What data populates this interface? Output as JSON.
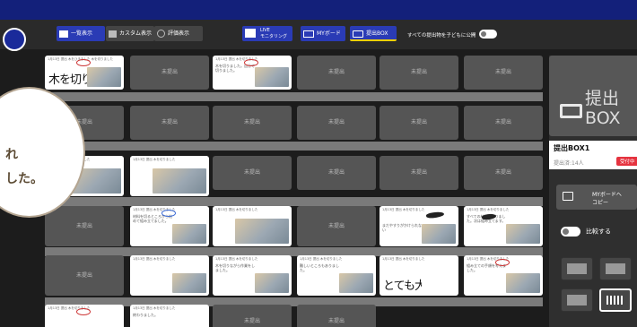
{
  "toolbar": {
    "list_view": "一覧表示",
    "custom_view": "カスタム表示",
    "eval_view": "評価表示",
    "live_top": "LIVE",
    "live_bottom": "モニタリング",
    "my_board": "MYボード",
    "submit_box": "提出BOX",
    "publish_label": "すべての提出物を子どもに公開"
  },
  "tiles": {
    "not_submitted": "未提出"
  },
  "submissions": [
    {
      "meta": "1月13日 提出 木をひきました 木を切りました",
      "body": "",
      "hand": "木を切りた"
    },
    {
      "meta": "1月13日 提出 木を切りました",
      "body": "木を切りました。自分で切りました。",
      "hand": ""
    },
    {
      "meta": "1月13日 提出 木を切りました",
      "body": "",
      "hand": ""
    },
    {
      "meta": "1月13日 提出 木を切りました",
      "body": "",
      "hand": ""
    },
    {
      "meta": "1月13日 提出 木を切りました",
      "body": "材料を切るところから始めて組み立てました。",
      "hand": ""
    },
    {
      "meta": "1月13日 提出 木を切りました",
      "body": "",
      "hand": ""
    },
    {
      "meta": "1月13日 提出 木を切りました",
      "body": "まだやすりがかけられない",
      "hand": ""
    },
    {
      "meta": "1月13日 提出 木を切りました",
      "body": "すべての材料を切りました。次は組み立てます。",
      "hand": ""
    },
    {
      "meta": "1月13日 提出 木を切りました",
      "body": "",
      "hand": ""
    },
    {
      "meta": "1月13日 提出 木を切りました",
      "body": "木を切りながら作業をしました。",
      "hand": ""
    },
    {
      "meta": "1月13日 提出 木を切りました",
      "body": "難しいところもありました。",
      "hand": ""
    },
    {
      "meta": "1月13日 提出 木を切りました",
      "body": "",
      "hand": ""
    },
    {
      "meta": "1月13日 提出 木を切りました",
      "body": "",
      "hand": "とても大"
    },
    {
      "meta": "1月13日 提出 木を切りました",
      "body": "組み立ての手順を考えました。",
      "hand": ""
    },
    {
      "meta": "1月13日 提出 木を切りました",
      "body": "",
      "hand": ""
    },
    {
      "meta": "1月13日 提出 木を切りました",
      "body": "終わりました。",
      "hand": ""
    }
  ],
  "panel": {
    "title_line1": "提出",
    "title_line2": "BOX",
    "box_name": "提出BOX1",
    "count": "提出済:14人",
    "status_badge": "受付中",
    "copy_line1": "MYボードへ",
    "copy_line2": "コピー",
    "compare": "比較する"
  },
  "bubble": {
    "line1": "れ",
    "line2": "した。"
  },
  "colors": {
    "topbar": "#13207a",
    "accent": "#2a3bb5",
    "badge": "#e5333f"
  }
}
